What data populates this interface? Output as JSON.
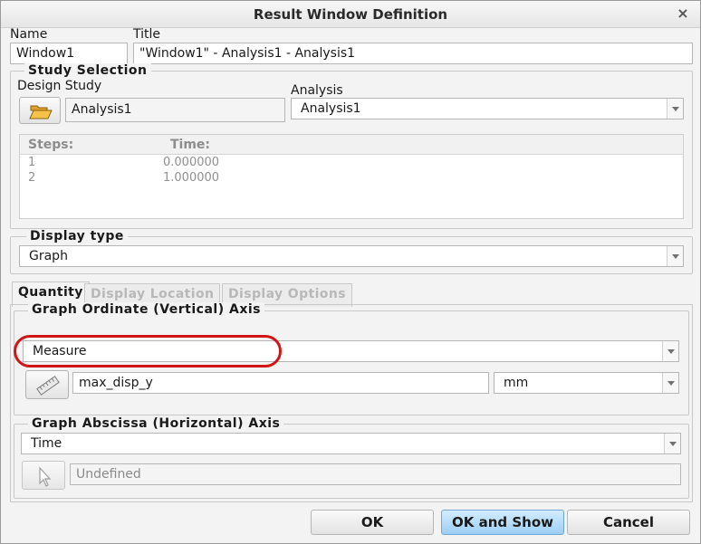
{
  "window": {
    "title": "Result Window Definition",
    "close_glyph": "×"
  },
  "name": {
    "label": "Name",
    "value": "Window1"
  },
  "title_field": {
    "label": "Title",
    "value": "\"Window1\" - Analysis1 - Analysis1"
  },
  "study_selection": {
    "group_label": "Study Selection",
    "design_study_label": "Design Study",
    "design_study_icon": "open-folder-icon",
    "design_study_value": "Analysis1",
    "analysis_label": "Analysis",
    "analysis_value": "Analysis1",
    "steps_table": {
      "columns": [
        "Steps:",
        "Time:"
      ],
      "rows": [
        [
          "1",
          "0.000000"
        ],
        [
          "2",
          "1.000000"
        ]
      ]
    }
  },
  "display_type": {
    "group_label": "Display type",
    "value": "Graph"
  },
  "tabs": [
    {
      "label": "Quantity",
      "active": true
    },
    {
      "label": "Display Location",
      "active": false
    },
    {
      "label": "Display Options",
      "active": false
    }
  ],
  "ordinate": {
    "group_label": "Graph Ordinate (Vertical) Axis",
    "quantity_value": "Measure",
    "measure_icon": "ruler-icon",
    "measure_value": "max_disp_y",
    "unit_value": "mm"
  },
  "abscissa": {
    "group_label": "Graph Abscissa (Horizontal) Axis",
    "quantity_value": "Time",
    "select_icon": "cursor-arrow-icon",
    "entity_placeholder": "Undefined"
  },
  "buttons": {
    "ok": "OK",
    "ok_and_show": "OK and Show",
    "cancel": "Cancel"
  },
  "colors": {
    "highlight": "#d31414",
    "primary_button": "#9ccff5"
  }
}
